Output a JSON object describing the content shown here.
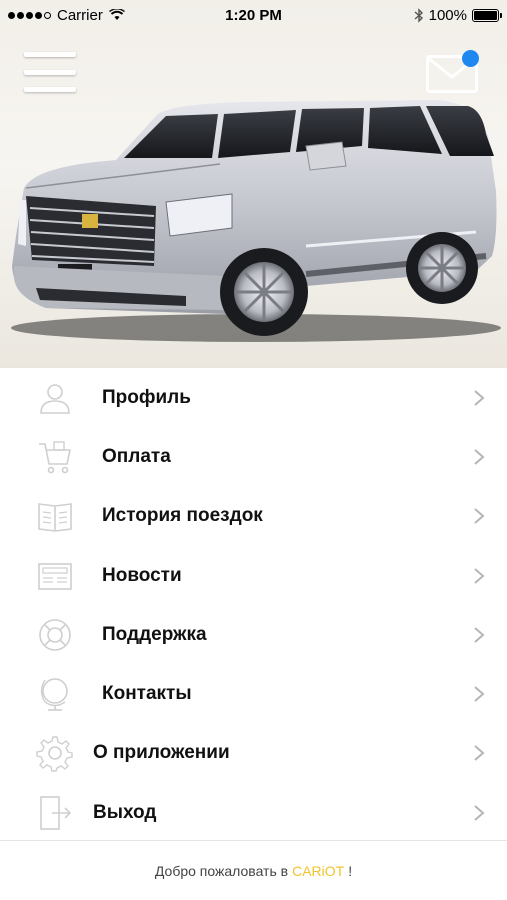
{
  "status_bar": {
    "carrier": "Carrier",
    "time": "1:20 PM",
    "battery": "100%"
  },
  "header": {
    "menu_icon": "hamburger-icon",
    "mail_icon": "envelope-icon",
    "mail_badge_color": "#1e88f0"
  },
  "menu": {
    "items": [
      {
        "label": "Профиль",
        "icon": "user-icon"
      },
      {
        "label": "Оплата",
        "icon": "cart-icon"
      },
      {
        "label": "История поездок",
        "icon": "book-icon"
      },
      {
        "label": "Новости",
        "icon": "newspaper-icon"
      },
      {
        "label": "Поддержка",
        "icon": "lifebuoy-icon"
      },
      {
        "label": "Контакты",
        "icon": "globe-icon"
      },
      {
        "label": "О приложении",
        "icon": "gear-icon"
      },
      {
        "label": "Выход",
        "icon": "exit-icon"
      }
    ]
  },
  "footer": {
    "prefix": "Добро пожаловать в",
    "brand": "CARiOT",
    "suffix": "!",
    "brand_color": "#f2c32b"
  }
}
